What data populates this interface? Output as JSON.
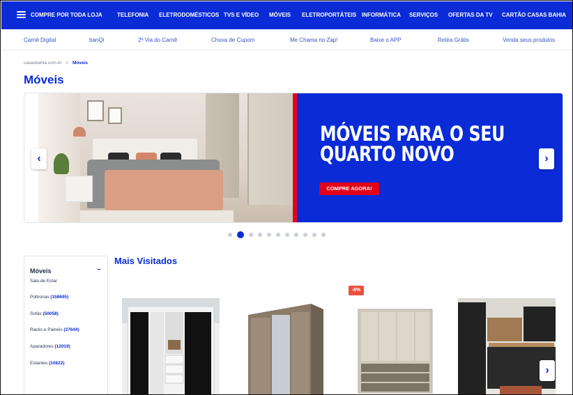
{
  "topnav": {
    "items": [
      "COMPRE POR TODA LOJA",
      "TELEFONIA",
      "ELETRODOMÉSTICOS",
      "TVS E VÍDEO",
      "MÓVEIS",
      "ELETROPORTÁTEIS",
      "INFORMÁTICA",
      "SERVIÇOS",
      "OFERTAS DA TV",
      "CARTÃO CASAS BAHIA"
    ]
  },
  "subnav": {
    "items": [
      "Carnê Digital",
      "banQi",
      "2ª Via do Carnê",
      "Chuva de Cupom",
      "Me Chama no Zap!",
      "Baixe o APP",
      "Retira Grátis",
      "Venda seus produtos"
    ]
  },
  "breadcrumb": {
    "home": "casasbahia.com.br",
    "separator": ">",
    "current": "Móveis"
  },
  "page_title": "Móveis",
  "banner": {
    "headline_line1": "MÓVEIS PARA O SEU",
    "headline_line2": "QUARTO NOVO",
    "cta": "COMPRE AGORA!",
    "prev_icon": "‹",
    "next_icon": "›",
    "slide_count": 11,
    "active_slide": 2
  },
  "sidebar": {
    "title": "Móveis",
    "collapse_icon": "–",
    "items": [
      {
        "label": "Sala de Estar",
        "count": ""
      },
      {
        "label": "Poltronas",
        "count": "(158695)"
      },
      {
        "label": "Sofás",
        "count": "(50058)"
      },
      {
        "label": "Racks e Painéis",
        "count": "(27644)"
      },
      {
        "label": "Aparadores",
        "count": "(12019)"
      },
      {
        "label": "Estantes",
        "count": "(10822)"
      }
    ]
  },
  "section_title": "Mais Visitados",
  "products": {
    "badge": "-8%",
    "next_icon": "›"
  },
  "colors": {
    "brand_blue": "#0a2bd6",
    "accent_red": "#e3001b",
    "discount": "#e8523d"
  }
}
